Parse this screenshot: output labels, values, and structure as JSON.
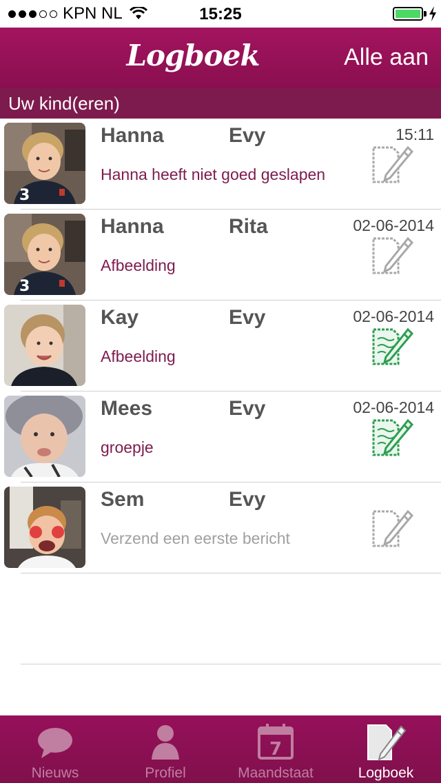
{
  "status_bar": {
    "carrier": "KPN NL",
    "time": "15:25",
    "signal_dots_on": 3,
    "signal_dots_total": 5
  },
  "nav": {
    "title": "Logboek",
    "right_button": "Alle aan"
  },
  "section_header": "Uw kind(eren)",
  "rows": [
    {
      "child": "Hanna",
      "carer": "Evy",
      "time": "15:11",
      "message": "Hanna heeft niet goed geslapen",
      "icon": "note-grey-icon"
    },
    {
      "child": "Hanna",
      "carer": "Rita",
      "time": "02-06-2014",
      "message": "Afbeelding",
      "icon": "note-grey-icon"
    },
    {
      "child": "Kay",
      "carer": "Evy",
      "time": "02-06-2014",
      "message": "Afbeelding",
      "icon": "note-green-icon"
    },
    {
      "child": "Mees",
      "carer": "Evy",
      "time": "02-06-2014",
      "message": "groepje",
      "icon": "note-green-icon"
    },
    {
      "child": "Sem",
      "carer": "Evy",
      "time": "",
      "message": "Verzend een eerste bericht",
      "icon": "note-grey-icon"
    }
  ],
  "tabs": [
    {
      "label": "Nieuws",
      "icon": "speech-bubble-icon"
    },
    {
      "label": "Profiel",
      "icon": "person-icon"
    },
    {
      "label": "Maandstaat",
      "icon": "calendar-icon",
      "calendar_day": "7"
    },
    {
      "label": "Logboek",
      "icon": "logbook-icon",
      "active": true
    }
  ],
  "colors": {
    "brand": "#9a1259",
    "section": "#7d1b4e",
    "message": "#7d1b4e",
    "note_green": "#2e9e4f",
    "note_grey": "#a0a0a0",
    "battery": "#4cd964"
  }
}
